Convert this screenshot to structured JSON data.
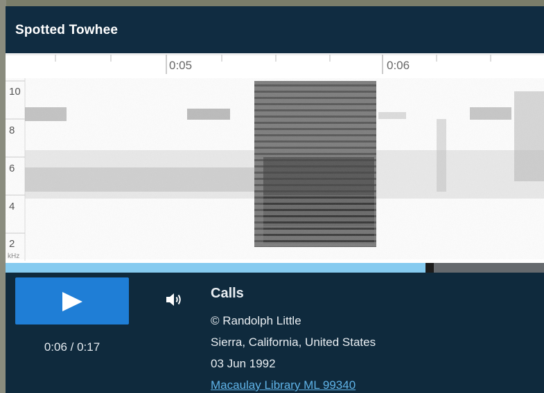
{
  "player": {
    "title": "Spotted Towhee"
  },
  "spectrogram": {
    "time_labels": [
      "0:05",
      "0:06"
    ],
    "frequency_labels": [
      "10",
      "8",
      "6",
      "4",
      "2"
    ],
    "frequency_unit": "kHz"
  },
  "playback": {
    "progress_fraction": 0.78,
    "time_readout": "0:06 / 0:17",
    "play_icon": "play-icon",
    "volume_icon": "volume-icon"
  },
  "recording": {
    "type": "Calls",
    "recordist": "© Randolph Little",
    "location": "Sierra, California, United States",
    "date": "03 Jun 1992",
    "catalog_link": "Macaulay Library ML 99340"
  },
  "colors": {
    "header": "#102c41",
    "panel": "#0f2a3d",
    "play_button": "#1f7ed6",
    "progress": "#86cbf0",
    "link": "#5fb3e8"
  }
}
